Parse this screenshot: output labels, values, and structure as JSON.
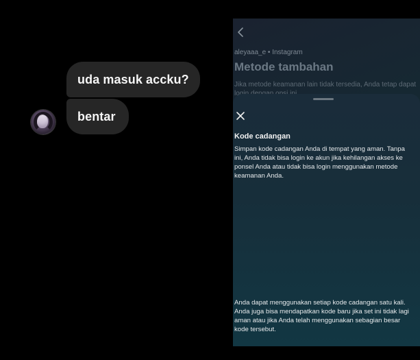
{
  "chat": {
    "messages": [
      {
        "text": "uda masuk accku?"
      },
      {
        "text": "bentar"
      }
    ]
  },
  "instagram": {
    "account_line": "aleyaaa_e • Instagram",
    "page_title": "Metode tambahan",
    "page_description": "Jika metode keamanan lain tidak tersedia, Anda tetap dapat login dengan opsi ini.",
    "sheet": {
      "title": "Kode cadangan",
      "body": "Simpan kode cadangan Anda di tempat yang aman. Tanpa ini, Anda tidak bisa login ke akun jika kehilangan akses ke ponsel Anda atau tidak bisa login menggunakan metode keamanan Anda.",
      "footer": "Anda dapat menggunakan setiap kode cadangan satu kali. Anda juga bisa mendapatkan kode baru jika set ini tidak lagi aman atau jika Anda telah menggunakan sebagian besar kode tersebut."
    }
  },
  "icons": {
    "back": "chevron-left-icon",
    "close": "close-icon"
  }
}
